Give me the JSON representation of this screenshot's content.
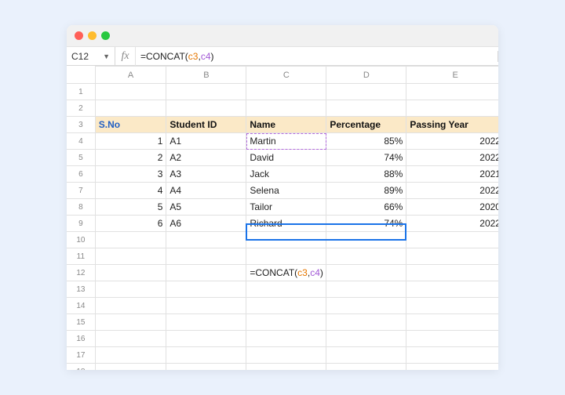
{
  "titlebar": {},
  "name_box": {
    "value": "C12"
  },
  "fx": "fx",
  "formula": {
    "prefix": "=CONCAT(",
    "arg1": "c3",
    "sep": ",",
    "arg2": "c4",
    "suffix": ")"
  },
  "columns": [
    "A",
    "B",
    "C",
    "D",
    "E"
  ],
  "row_count": 19,
  "header_row": 3,
  "headers": {
    "sno": "S.No",
    "student_id": "Student ID",
    "name": "Name",
    "percentage": "Percentage",
    "passing_year": "Passing Year"
  },
  "rows": [
    {
      "sno": "1",
      "student_id": "A1",
      "name": "Martin",
      "percentage": "85%",
      "year": "2022"
    },
    {
      "sno": "2",
      "student_id": "A2",
      "name": "David",
      "percentage": "74%",
      "year": "2022"
    },
    {
      "sno": "3",
      "student_id": "A3",
      "name": "Jack",
      "percentage": "88%",
      "year": "2021"
    },
    {
      "sno": "4",
      "student_id": "A4",
      "name": "Selena",
      "percentage": "89%",
      "year": "2022"
    },
    {
      "sno": "5",
      "student_id": "A5",
      "name": "Tailor",
      "percentage": "66%",
      "year": "2020"
    },
    {
      "sno": "6",
      "student_id": "A6",
      "name": "Richard",
      "percentage": "74%",
      "year": "2022"
    }
  ],
  "active_cell": {
    "row": 12,
    "col": "C"
  },
  "ref_highlight_cell": {
    "row": 4,
    "col": "C"
  },
  "cell_formula": {
    "prefix": "=CONCAT(",
    "arg1": "c3",
    "sep": ",",
    "arg2": "c4",
    "suffix": ")"
  }
}
